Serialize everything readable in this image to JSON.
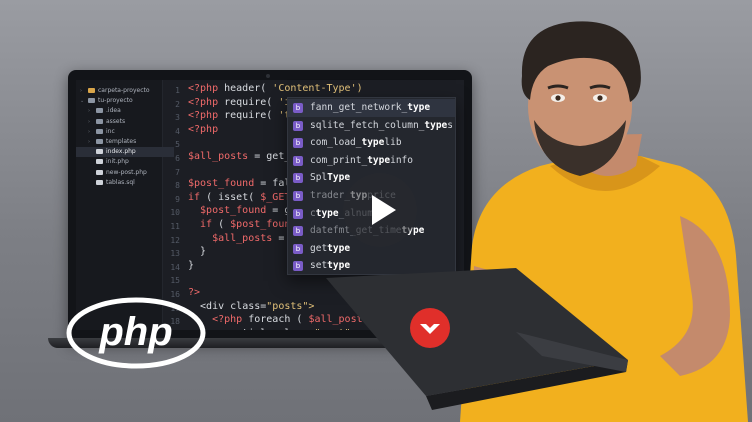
{
  "sidebar": {
    "items": [
      {
        "label": "carpeta-proyecto",
        "type": "folder-gold",
        "arrow": "›"
      },
      {
        "label": "tu-proyecto",
        "type": "folder",
        "arrow": "⌄"
      },
      {
        "label": ".idea",
        "type": "folder",
        "arrow": "›"
      },
      {
        "label": "assets",
        "type": "folder",
        "arrow": "›"
      },
      {
        "label": "inc",
        "type": "folder",
        "arrow": "›"
      },
      {
        "label": "templates",
        "type": "folder",
        "arrow": "›"
      },
      {
        "label": "index.php",
        "type": "file",
        "arrow": "",
        "selected": true
      },
      {
        "label": "init.php",
        "type": "file",
        "arrow": ""
      },
      {
        "label": "new-post.php",
        "type": "file",
        "arrow": ""
      },
      {
        "label": "tablas.sql",
        "type": "file",
        "arrow": ""
      }
    ]
  },
  "editor": {
    "line_numbers": [
      "1",
      "2",
      "3",
      "4",
      "5",
      "6",
      "7",
      "8",
      "9",
      "10",
      "11",
      "12",
      "13",
      "14",
      "15",
      "16",
      "17",
      "18"
    ],
    "lines": [
      [
        {
          "t": "<?php ",
          "c": "kw"
        },
        {
          "t": "header( ",
          "c": "fn"
        },
        {
          "t": "'Content-Type')",
          "c": "st"
        }
      ],
      [
        {
          "t": "<?php ",
          "c": "kw"
        },
        {
          "t": "require( ",
          "c": "fn"
        },
        {
          "t": "'in",
          "c": "st"
        }
      ],
      [
        {
          "t": "<?php ",
          "c": "kw"
        },
        {
          "t": "require( ",
          "c": "fn"
        },
        {
          "t": "'ter",
          "c": "st"
        }
      ],
      [
        {
          "t": "<?php",
          "c": "kw"
        }
      ],
      [],
      [
        {
          "t": "$all_posts",
          "c": "vr"
        },
        {
          "t": " = get_al",
          "c": "pl"
        }
      ],
      [],
      [
        {
          "t": "$post_found",
          "c": "vr"
        },
        {
          "t": " = false",
          "c": "pl"
        }
      ],
      [
        {
          "t": "if",
          "c": "kw"
        },
        {
          "t": " ( isset( ",
          "c": "pl"
        },
        {
          "t": "$_GET['",
          "c": "vr"
        }
      ],
      [
        {
          "t": "  $post_found",
          "c": "vr"
        },
        {
          "t": " = get",
          "c": "pl"
        }
      ],
      [
        {
          "t": "  if",
          "c": "kw"
        },
        {
          "t": " ( ",
          "c": "pl"
        },
        {
          "t": "$post_found",
          "c": "vr"
        }
      ],
      [
        {
          "t": "    $all_posts",
          "c": "vr"
        },
        {
          "t": " = [",
          "c": "pl"
        }
      ],
      [
        {
          "t": "  }",
          "c": "pl"
        }
      ],
      [
        {
          "t": "}",
          "c": "pl"
        }
      ],
      [],
      [
        {
          "t": "?>",
          "c": "kw"
        }
      ],
      [
        {
          "t": "  <div ",
          "c": "pl"
        },
        {
          "t": "class=",
          "c": "pl"
        },
        {
          "t": "\"posts\">",
          "c": "st"
        }
      ],
      [
        {
          "t": "    <?php ",
          "c": "kw"
        },
        {
          "t": "foreach ( ",
          "c": "pl"
        },
        {
          "t": "$all_posts",
          "c": "vr"
        }
      ],
      [
        {
          "t": "      <article ",
          "c": "pl"
        },
        {
          "t": "class=",
          "c": "pl"
        },
        {
          "t": "\"post\">",
          "c": "st"
        }
      ]
    ]
  },
  "autocomplete": {
    "badge": "b",
    "items": [
      {
        "pre": "fann_get_network_",
        "bold": "type",
        "post": "",
        "selected": true
      },
      {
        "pre": "sqlite_fetch_column_",
        "bold": "type",
        "post": "s"
      },
      {
        "pre": "com_load_",
        "bold": "type",
        "post": "lib"
      },
      {
        "pre": "com_print_",
        "bold": "type",
        "post": "info"
      },
      {
        "pre": "Spl",
        "bold": "Type",
        "post": ""
      },
      {
        "pre": "trader_",
        "bold": "typ",
        "post": "price"
      },
      {
        "pre": "c",
        "bold": "type",
        "post": "_alnum"
      },
      {
        "pre": "datefmt_get_time",
        "bold": "type",
        "post": ""
      },
      {
        "pre": "get",
        "bold": "type",
        "post": ""
      },
      {
        "pre": "set",
        "bold": "type",
        "post": ""
      }
    ]
  },
  "logo": {
    "text": "php"
  },
  "colors": {
    "accent_red": "#e02f2a",
    "badge": "#7a5cc7",
    "shirt": "#f2b01e"
  }
}
